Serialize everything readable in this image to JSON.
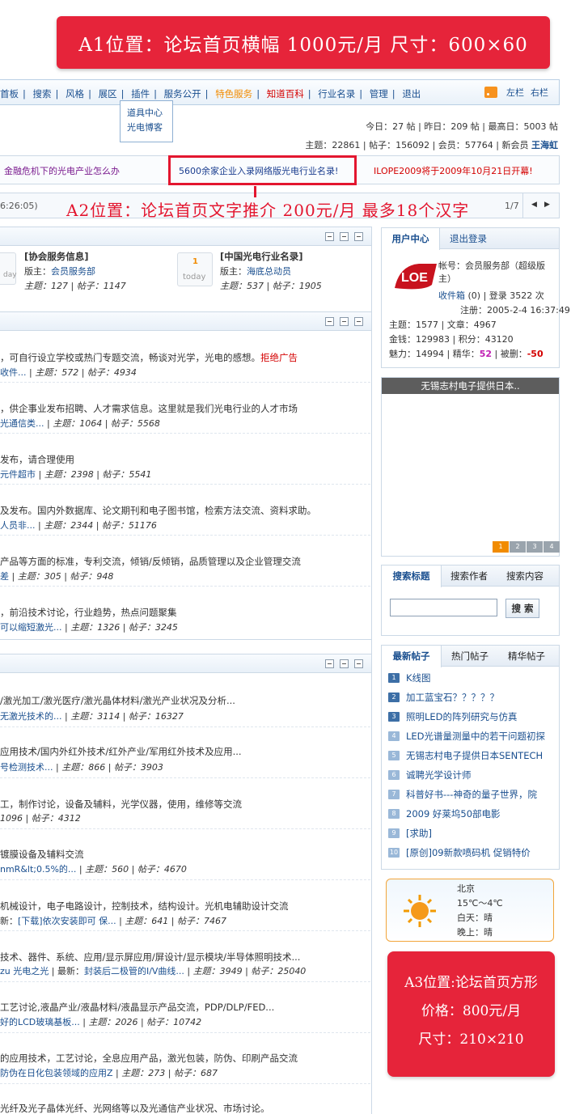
{
  "ads": {
    "a1": "A1位置：论坛首页横幅 1000元/月  尺寸：600×60",
    "a2": "A2位置：论坛首页文字推介 200元/月  最多18个汉字",
    "a3": {
      "line1": "A3位置:论坛首页方形",
      "line2": "价格：800元/月",
      "line3": "尺寸：210×210"
    }
  },
  "nav": {
    "items": [
      "首板",
      "搜索",
      "风格",
      "展区",
      "插件",
      "服务公开",
      "特色服务",
      "知道百科",
      "行业名录",
      "管理",
      "退出"
    ],
    "left_col": "左栏",
    "right_col": "右栏",
    "dropdown": [
      "道具中心",
      "光电博客"
    ]
  },
  "stats": {
    "line1": "今日：27 帖 | 昨日：209 帖 | 最高日：5003 帖",
    "line2_prefix": "主题：22861 | 帖子：156092 | 会员：57764 | 新会员",
    "newest_member": "王海虹"
  },
  "headlines": [
    "金融危机下的光电产业怎么办",
    "5600余家企业入录网络版光电行业名录!",
    "ILOPE2009将于2009年10月21日开幕!"
  ],
  "ticker": {
    "time": "6:26:05)",
    "page": "1/7"
  },
  "top_forums": [
    {
      "today": "day",
      "title": "[协会服务信息]",
      "moderator_label": "版主：",
      "moderator": "会员服务部",
      "stats": "主题：127 | 帖子：1147"
    },
    {
      "today_num": "1",
      "today": "today",
      "title": "[中国光电行业名录]",
      "moderator_label": "版主：",
      "moderator": "海底总动员",
      "stats": "主题：537 | 帖子：1905"
    }
  ],
  "section1": [
    {
      "desc": "，可自行设立学校或热门专题交流，畅谈对光学，光电的感想。",
      "desc_red": "拒绝广告",
      "last": "收件...",
      "stats": "| 主题：572 | 帖子：4934"
    },
    {
      "desc": "，供企事业发布招聘、人才需求信息。这里就是我们光电行业的人才市场",
      "last": "光通信类...",
      "stats": "| 主题：1064 | 帖子：5568"
    },
    {
      "desc": "发布，请合理使用",
      "last": "元件超市",
      "stats": "| 主题：2398 | 帖子：5541"
    },
    {
      "desc": "及发布。国内外数据库、论文期刊和电子图书馆，检索方法交流、资料求助。",
      "last": "人员非...",
      "stats": "| 主题：2344 | 帖子：51176"
    },
    {
      "desc": "产品等方面的标准，专利交流，倾销/反倾销，品质管理以及企业管理交流",
      "last": "差",
      "stats": "| 主题：305 | 帖子：948"
    },
    {
      "desc": "，前沿技术讨论，行业趋势，热点问题聚集",
      "last": "可以缩短激光...",
      "stats": "| 主题：1326 | 帖子：3245"
    }
  ],
  "section2": [
    {
      "desc": "/激光加工/激光医疗/激光晶体材料/激光产业状况及分析...",
      "last": "无激光技术的...",
      "stats": "| 主题：3114 | 帖子：16327"
    },
    {
      "desc": "应用技术/国内外红外技术/红外产业/军用红外技术及应用...",
      "last": "号检测技术...",
      "stats": "| 主题：866 | 帖子：3903"
    },
    {
      "desc": "工，制作讨论，设备及辅料，光学仪器，使用，维修等交流",
      "last": "",
      "stats": "1096 | 帖子：4312"
    },
    {
      "desc": "镀膜设备及辅料交流",
      "last": "nmR&lt;0.5%的...",
      "stats": "| 主题：560 | 帖子：4670"
    },
    {
      "desc": "机械设计，电子电路设计，控制技术，结构设计。光机电辅助设计交流",
      "last_prefix": "新：",
      "last": "[下载]依次安装即可 保...",
      "stats": "| 主题：641 | 帖子：7467"
    },
    {
      "desc": "技术、器件、系统、应用/显示屏应用/屏设计/显示模块/半导体照明技术...",
      "last_prefix": "zu  ",
      "last_extra": "光电之光",
      "last_label": " | 最新：",
      "last": "封装后二极管的I/V曲线...",
      "stats": "| 主题：3949 | 帖子：25040"
    },
    {
      "desc": "工艺讨论,液晶产业/液晶材料/液晶显示产品交流，PDP/DLP/FED...",
      "last": "好的LCD玻璃基板...",
      "stats": "| 主题：2026 | 帖子：10742"
    },
    {
      "desc": "的应用技术，工艺讨论，全息应用产品，激光包装，防伪、印刷产品交流",
      "last": "防伪在日化包装领域的应用Z",
      "stats": "| 主题：273 | 帖子：687"
    },
    {
      "desc": "光纤及光子晶体光纤、光网络等以及光通信产业状况、市场讨论。",
      "last": "",
      "stats": ""
    }
  ],
  "user_center": {
    "tab_active": "用户中心",
    "tab_logout": "退出登录",
    "account": "帐号：会员服务部（超级版主）",
    "inbox_label": "收件箱",
    "inbox_rest": "(0) | 登录  3522 次",
    "register": "注册：2005-2-4 16:37:49",
    "line_topics": "主题：1577 | 文章：4967",
    "line_money": "金钱：129983 | 积分：43120",
    "charm_prefix": "魅力：14994 | 精华：",
    "essence": "52",
    "deleted_label": " | 被删：",
    "deleted": "-50",
    "logo_text": "LOE"
  },
  "slideshow": {
    "title": "无锡志村电子提供日本..",
    "pages": [
      "1",
      "2",
      "3",
      "4"
    ]
  },
  "search": {
    "tabs": [
      "搜索标题",
      "搜索作者",
      "搜索内容"
    ],
    "button": "搜 索",
    "placeholder": ""
  },
  "latest_posts": {
    "tabs": [
      "最新帖子",
      "热门帖子",
      "精华帖子"
    ],
    "items": [
      "K线图",
      "加工蓝宝石？？？？？",
      "照明LED的阵列研究与仿真",
      "LED光谱量测量中的若干问题初探",
      "无锡志村电子提供日本SENTECH",
      "诚聘光学设计师",
      "科普好书---神奇的量子世界，院",
      "2009 好莱坞50部电影",
      "[求助]",
      "[原创]09新款喷码机  促销特价"
    ]
  },
  "weather": {
    "city": "北京",
    "temp": "15℃～4℃",
    "day": "白天：晴",
    "night": "晚上：晴"
  },
  "colors": {
    "ad_red": "#e6243a",
    "link_blue": "#1a4f8f",
    "nav_orange": "#f18b00",
    "nav_red": "#d40000"
  }
}
